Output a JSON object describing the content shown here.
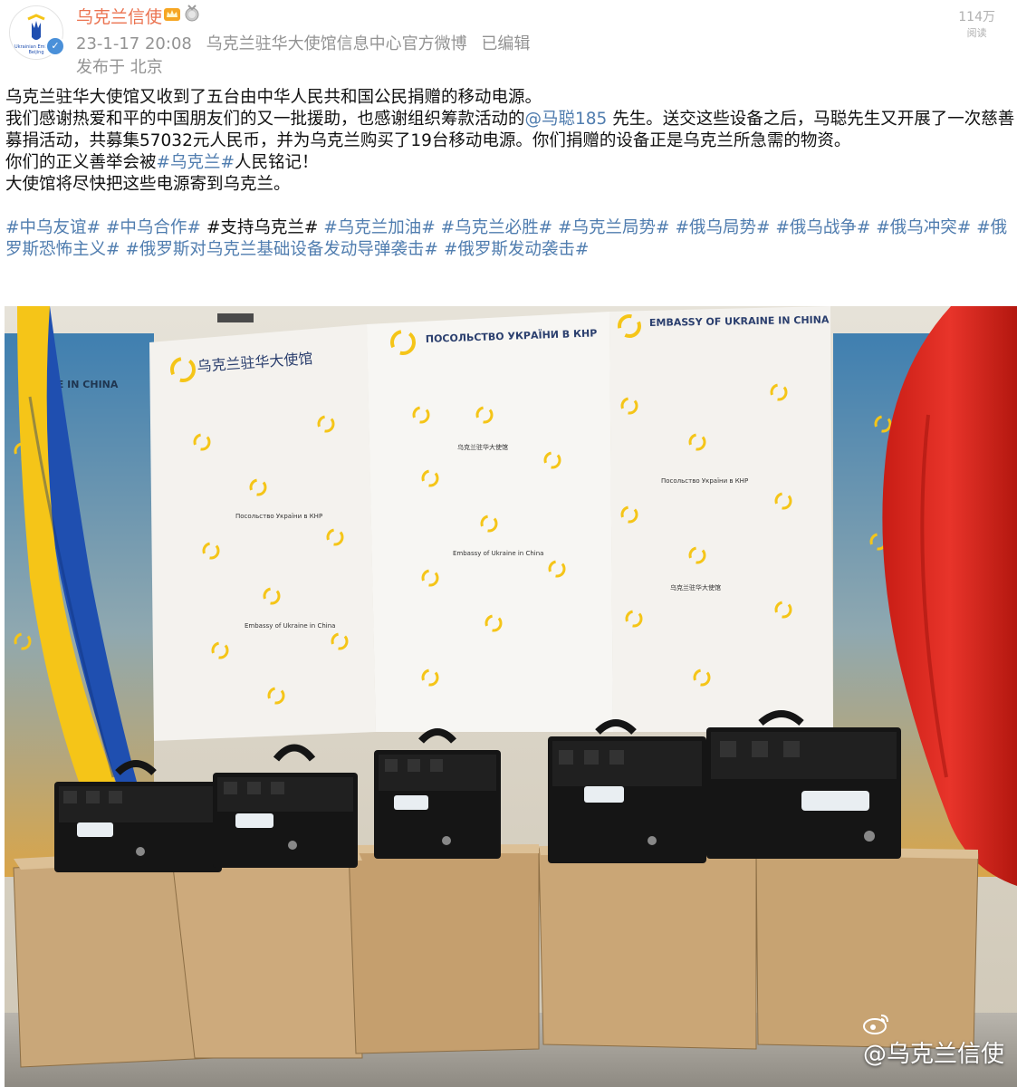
{
  "post": {
    "username": "乌克兰信使",
    "badges": [
      "crown-badge",
      "medal-badge"
    ],
    "verified_icon": "verified-check-icon",
    "timestamp": "23-1-17 20:08",
    "source": "乌克兰驻华大使馆信息中心官方微博",
    "edited": "已编辑",
    "location": "发布于 北京",
    "read_count": "114万",
    "read_label": "阅读"
  },
  "body": {
    "line1": "乌克兰驻华大使馆又收到了五台由中华人民共和国公民捐赠的移动电源。",
    "line2_before": "我们感谢热爱和平的中国朋友们的又一批援助，也感谢组织筹款活动的",
    "mention": "@马聪185",
    "line2_after": "先生。送交这些设备之后，马聪先生又开展了一次慈善募捐活动，共募集57032元人民币，并为乌克兰购买了19台移动电源。你们捐赠的设备正是乌克兰所急需的物资。",
    "line3_before": "你们的正义善举会被",
    "line3_tag": "#乌克兰#",
    "line3_after": "人民铭记！",
    "line4": "大使馆将尽快把这些电源寄到乌克兰。"
  },
  "hashtags": [
    {
      "text": "#中乌友谊#",
      "linked": true
    },
    {
      "text": "#中乌合作#",
      "linked": true
    },
    {
      "text": "#支持乌克兰#",
      "linked": false
    },
    {
      "text": "#乌克兰加油#",
      "linked": true
    },
    {
      "text": "#乌克兰必胜#",
      "linked": true
    },
    {
      "text": "#乌克兰局势#",
      "linked": true
    },
    {
      "text": "#俄乌局势#",
      "linked": true
    },
    {
      "text": "#俄乌战争#",
      "linked": true
    },
    {
      "text": "#俄乌冲突#",
      "linked": true
    },
    {
      "text": "#俄罗斯恐怖主义#",
      "linked": true
    },
    {
      "text": "#俄罗斯对乌克兰基础设备发动导弹袭击#",
      "linked": true
    },
    {
      "text": "#俄罗斯发动袭击#",
      "linked": true
    }
  ],
  "photo": {
    "banner_texts": {
      "chinese": "乌克兰驻华大使馆",
      "ukrainian": "ПОСОЛЬСТВО УКРАЇНИ В КНР",
      "english": "EMBASSY OF UKRAINE IN CHINA",
      "left_panel": "AINE IN CHINA"
    },
    "small_texts": [
      "乌克兰驻华大使馆",
      "Посольство України в КНР",
      "Embassy of Ukraine in China"
    ],
    "colors": {
      "ukraine_blue": "#1f4fb0",
      "ukraine_yellow": "#f5c518",
      "china_red": "#e0261c",
      "box_brown": "#c9a779",
      "device_black": "#151515"
    },
    "watermark": "@乌克兰信使"
  }
}
